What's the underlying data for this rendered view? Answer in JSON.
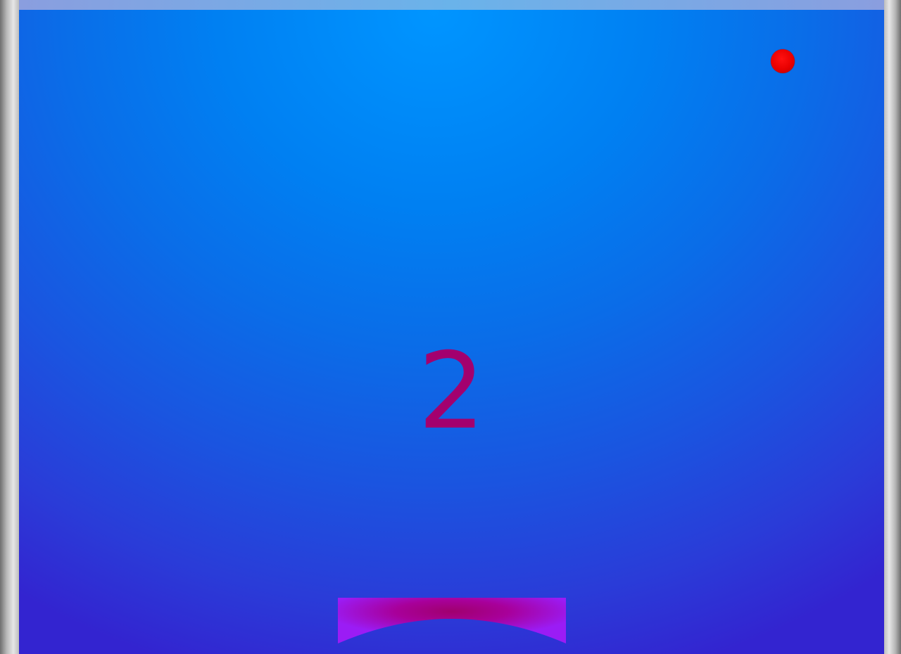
{
  "game": {
    "score": "2",
    "icons": {
      "ball": "ball-icon",
      "paddle": "paddle-icon"
    },
    "colors": {
      "score": "#a3006e",
      "ball": "#ff0000",
      "paddle_edge": "#9b1cf5",
      "paddle_center": "#a0006e",
      "background_top": "#0095ff",
      "background_bottom": "#3324d0",
      "wall": "#c0c0c0"
    }
  }
}
